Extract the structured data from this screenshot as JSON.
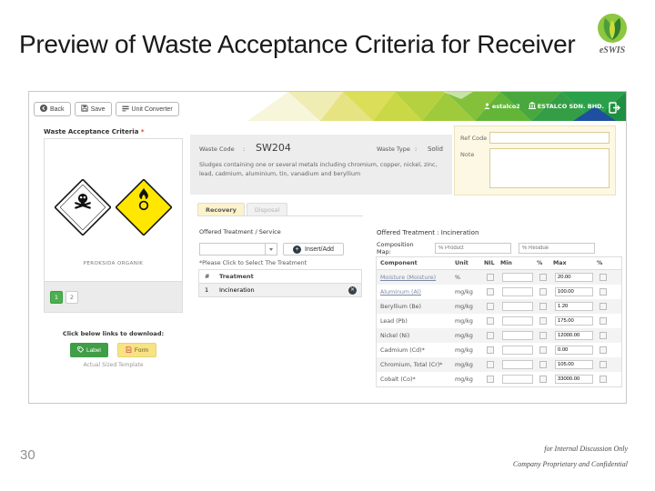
{
  "slide": {
    "title": "Preview of Waste Acceptance Criteria for Receiver",
    "page_number": "30",
    "footer_line1": "for Internal Discussion Only",
    "footer_line2": "Company Proprietary and Confidential",
    "logo_text": "eSWIS"
  },
  "header": {
    "username": "estalco2",
    "company": "ESTALCO SDN. BHD."
  },
  "toolbar": {
    "back": "Back",
    "save": "Save",
    "unit_converter": "Unit Converter"
  },
  "left_panel": {
    "title": "Waste Acceptance Criteria",
    "required": "*",
    "caption": "PEROKSIDA ORGANIK",
    "page1": "1",
    "page2": "2",
    "download_hint": "Click below links to download:",
    "label_btn": "Label",
    "form_btn": "Form",
    "template_note": "Actual Sized Template"
  },
  "waste_info": {
    "code_label": "Waste Code",
    "colon": ":",
    "code_value": "SW204",
    "type_label": "Waste Type",
    "type_value": "Solid",
    "description": "Sludges containing one or several metals including chromium, copper, nickel, zinc, lead, cadmium, aluminium, tin, vanadium and beryllium"
  },
  "side_panel": {
    "ref_code_label": "Ref Code",
    "note_label": "Note"
  },
  "treatment": {
    "tab_recovery": "Recovery",
    "tab_disposal": "Disposal",
    "offered_label": "Offered Treatment / Service",
    "insert_add": "Insert/Add",
    "hint": "*Please Click to Select The Treatment",
    "col_num": "#",
    "col_treatment": "Treatment",
    "row1_num": "1",
    "row1_value": "Incineration"
  },
  "composition": {
    "offered_treatment": "Offered Treatment : Incineration",
    "map_label": "Composition Map:",
    "product_placeholder": "% Product",
    "residue_placeholder": "% Residue",
    "headers": {
      "component": "Component",
      "unit": "Unit",
      "nil": "NIL",
      "min": "Min",
      "pct1": "%",
      "max": "Max",
      "pct2": "%"
    },
    "rows": [
      {
        "component": "Moisture (Moisture)",
        "unit": "%",
        "max": "20.00"
      },
      {
        "component": "Aluminum (Al)",
        "unit": "mg/kg",
        "max": "100.00"
      },
      {
        "component": "Beryllium (Be)",
        "unit": "mg/kg",
        "max": "1.20"
      },
      {
        "component": "Lead (Pb)",
        "unit": "mg/kg",
        "max": "175.00"
      },
      {
        "component": "Nickel (Ni)",
        "unit": "mg/kg",
        "max": "12000.00"
      },
      {
        "component": "Cadmium (Cd)*",
        "unit": "mg/kg",
        "max": "0.00"
      },
      {
        "component": "Chromium, Total (Cr)*",
        "unit": "mg/kg",
        "max": "105.00"
      },
      {
        "component": "Cobalt (Co)*",
        "unit": "mg/kg",
        "max": "33000.00"
      }
    ]
  },
  "colors": {
    "accent_green": "#43a047",
    "band_blue": "#1d509e",
    "form_yellow": "#f7e385",
    "panel_cream": "#fcf8e3",
    "panel_gray": "#ededed"
  }
}
